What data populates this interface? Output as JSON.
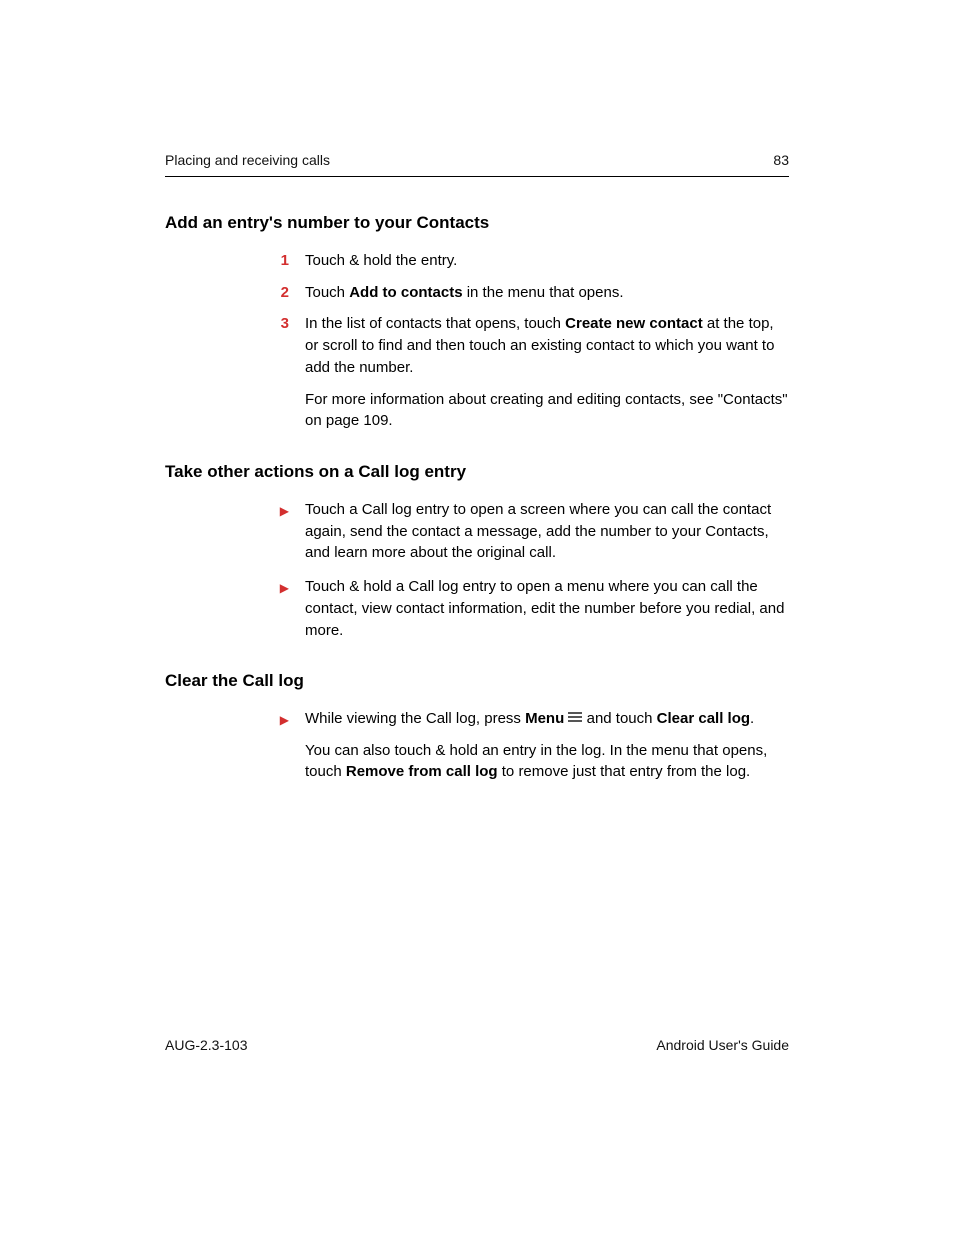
{
  "header": {
    "section": "Placing and receiving calls",
    "page_number": "83"
  },
  "sections": {
    "add_entry": {
      "title": "Add an entry's number to your Contacts",
      "step1": {
        "num": "1",
        "text": "Touch & hold the entry."
      },
      "step2": {
        "num": "2",
        "pre": "Touch ",
        "bold": "Add to contacts",
        "post": " in the menu that opens."
      },
      "step3": {
        "num": "3",
        "pre": "In the list of contacts that opens, touch ",
        "bold": "Create new contact",
        "post": " at the top, or scroll to find and then touch an existing contact to which you want to add the number.",
        "para2": "For more information about creating and editing contacts, see \"Contacts\" on page 109."
      }
    },
    "other_actions": {
      "title": "Take other actions on a Call log entry",
      "b1": "Touch a Call log entry to open a screen where you can call the contact again, send the contact a message, add the number to your Contacts, and learn more about the original call.",
      "b2": "Touch & hold a Call log entry to open a menu where you can call the contact, view contact information, edit the number before you redial, and more."
    },
    "clear_log": {
      "title": "Clear the Call log",
      "b1": {
        "pre": "While viewing the Call log, press ",
        "bold1": "Menu",
        "mid": " and touch ",
        "bold2": "Clear call log",
        "post": "."
      },
      "p2": {
        "pre": "You can also touch & hold an entry in the log. In the menu that opens, touch ",
        "bold": "Remove from call log",
        "post": " to remove just that entry from the log."
      }
    }
  },
  "footer": {
    "left": "AUG-2.3-103",
    "right": "Android User's Guide"
  }
}
